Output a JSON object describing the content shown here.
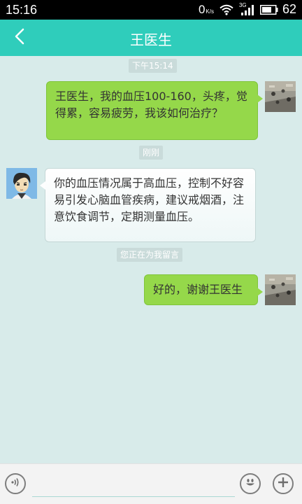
{
  "status_bar": {
    "time": "15:16",
    "net_speed_value": "0",
    "net_speed_unit": "K/s",
    "network_type": "3G",
    "battery_level": "62"
  },
  "header": {
    "title": "王医生"
  },
  "messages": [
    {
      "type": "timestamp",
      "text": "下午15:14"
    },
    {
      "type": "sent",
      "text": "王医生，我的血压100-160，头疼，觉得累，容易疲劳，我该如何治疗？"
    },
    {
      "type": "timestamp",
      "text": "刚刚"
    },
    {
      "type": "received",
      "text": "你的血压情况属于高血压，控制不好容易引发心脑血管疾病，建议戒烟酒，注意饮食调节，定期测量血压。"
    },
    {
      "type": "timestamp",
      "text": "您正在为我留言"
    },
    {
      "type": "sent",
      "text": "好的，谢谢王医生"
    }
  ],
  "input": {
    "placeholder": ""
  },
  "colors": {
    "accent": "#2fcdbb",
    "sent_bubble": "#95d84a",
    "background": "#d8ebea"
  },
  "icons": {
    "back": "chevron-left-icon",
    "voice": "voice-icon",
    "emoji": "emoji-icon",
    "plus": "plus-icon"
  }
}
